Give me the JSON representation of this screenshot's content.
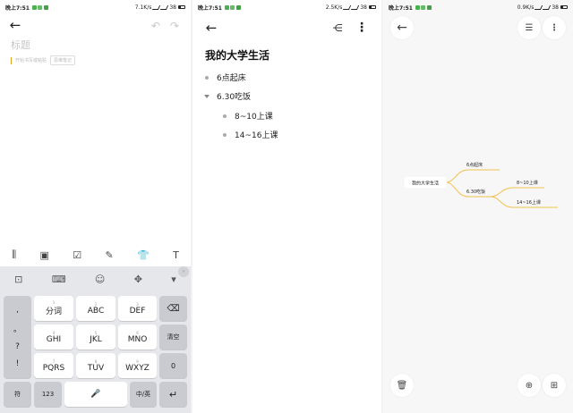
{
  "screens": [
    {
      "status": {
        "time": "晚上7:51",
        "speed": "7.1K/s",
        "battery": "38"
      },
      "title_placeholder": "标题",
      "tags": [
        "开始书写或粘贴",
        "思维笔记"
      ],
      "toolbar_icons": [
        "audio-icon",
        "image-icon",
        "checkbox-icon",
        "pen-icon",
        "shirt-icon",
        "text-icon"
      ],
      "keyboard": {
        "top_icons": [
          "toolbox-icon",
          "keyboard-icon",
          "emoji-icon",
          "cursor-move-icon",
          "hide-keyboard-icon"
        ],
        "left_col": [
          ",",
          "。",
          "?",
          "!"
        ],
        "keys": [
          {
            "label": "分词",
            "sub": "1"
          },
          {
            "label": "ABC",
            "sub": "2"
          },
          {
            "label": "DEF",
            "sub": "3"
          },
          {
            "label": "GHI",
            "sub": "4"
          },
          {
            "label": "JKL",
            "sub": "5"
          },
          {
            "label": "MNO",
            "sub": "6"
          },
          {
            "label": "PQRS",
            "sub": "7"
          },
          {
            "label": "TUV",
            "sub": "8"
          },
          {
            "label": "WXYZ",
            "sub": "9"
          }
        ],
        "right_col": [
          "⌫",
          "清空",
          "0",
          "↵"
        ],
        "bottom": {
          "symbol": "符",
          "num": "123",
          "space": "🎤",
          "lang": "中/英"
        }
      }
    },
    {
      "status": {
        "time": "晚上7:51",
        "speed": "2.5K/s",
        "battery": "38"
      },
      "doc_title": "我的大学生活",
      "outline": [
        {
          "text": "6点起床",
          "level": 0,
          "marker": "bullet"
        },
        {
          "text": "6.30吃饭",
          "level": 0,
          "marker": "triangle"
        },
        {
          "text": "8~10上课",
          "level": 1,
          "marker": "bullet"
        },
        {
          "text": "14~16上课",
          "level": 1,
          "marker": "bullet"
        }
      ]
    },
    {
      "status": {
        "time": "晚上7:51",
        "speed": "0.9K/s",
        "battery": "38"
      },
      "mindmap": {
        "root": "我的大学生活",
        "branch1": "6点起床",
        "branch2": "6.30吃饭",
        "leaf1": "8~10上课",
        "leaf2": "14~16上课"
      },
      "line_color": "#f2c14e"
    }
  ]
}
